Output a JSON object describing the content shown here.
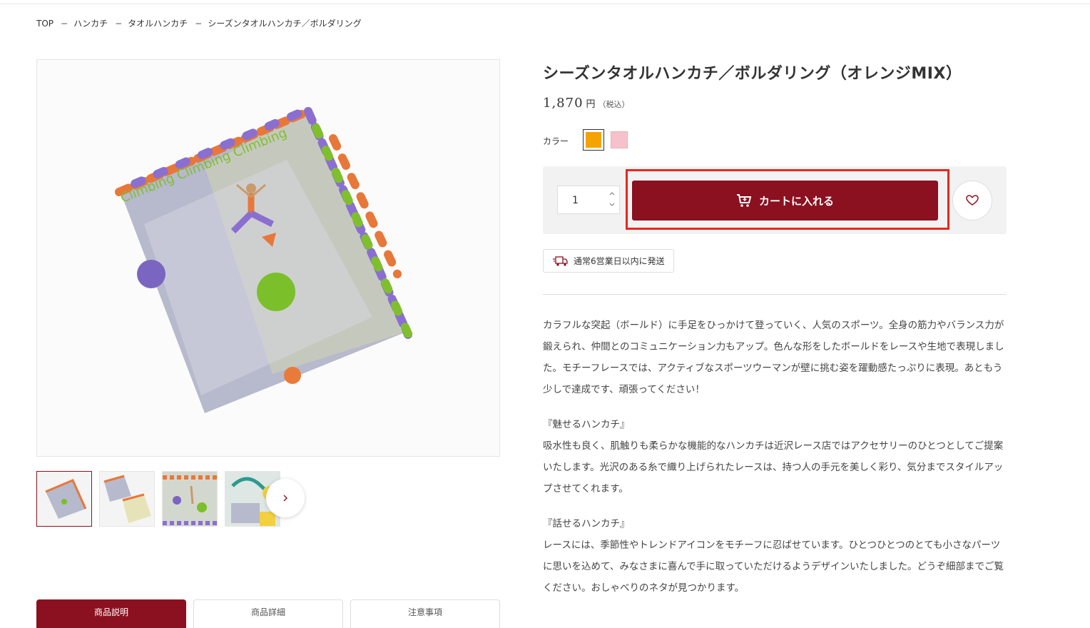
{
  "breadcrumb": {
    "items": [
      "TOP",
      "ハンカチ",
      "タオルハンカチ",
      "シーズンタオルハンカチ／ボルダリング"
    ],
    "separator": "−"
  },
  "product": {
    "title": "シーズンタオルハンカチ／ボルダリング（オレンジMIX）",
    "price": "1,870",
    "currency": "円",
    "tax_note": "（税込）",
    "color_label": "カラー",
    "colors": [
      {
        "name": "orange",
        "hex": "#f5a300",
        "selected": true
      },
      {
        "name": "pink",
        "hex": "#f7c1cb",
        "selected": false
      }
    ],
    "quantity": "1",
    "cart_button": "カートに入れる",
    "shipping": "通常6営業日以内に発送"
  },
  "description": {
    "p1": "カラフルな突起（ボールド）に手足をひっかけて登っていく、人気のスポーツ。全身の筋力やバランス力が鍛えられ、仲間とのコミュニケーション力もアップ。色んな形をしたボールドをレースや生地で表現しました。モチーフレースでは、アクティブなスポーツウーマンが壁に挑む姿を躍動感たっぷりに表現。あともう少しで達成です、頑張ってください！",
    "h2": "『魅せるハンカチ』",
    "p2": "吸水性も良く、肌触りも柔らかな機能的なハンカチは近沢レース店ではアクセサリーのひとつとしてご提案いたします。光沢のある糸で織り上げられたレースは、持つ人の手元を美しく彩り、気分までスタイルアップさせてくれます。",
    "h3": "『話せるハンカチ』",
    "p3": "レースには、季節性やトレンドアイコンをモチーフに忍ばせています。ひとつひとつのとても小さなパーツに思いを込めて、みなさまに喜んで手に取っていただけるようデザインいたしました。どうぞ細部までご覧ください。おしゃべりのネタが見つかります。"
  },
  "tabs": [
    "商品説明",
    "商品詳細",
    "注意事項"
  ],
  "colors": {
    "accent": "#8b1020",
    "highlight": "#e8271c"
  }
}
